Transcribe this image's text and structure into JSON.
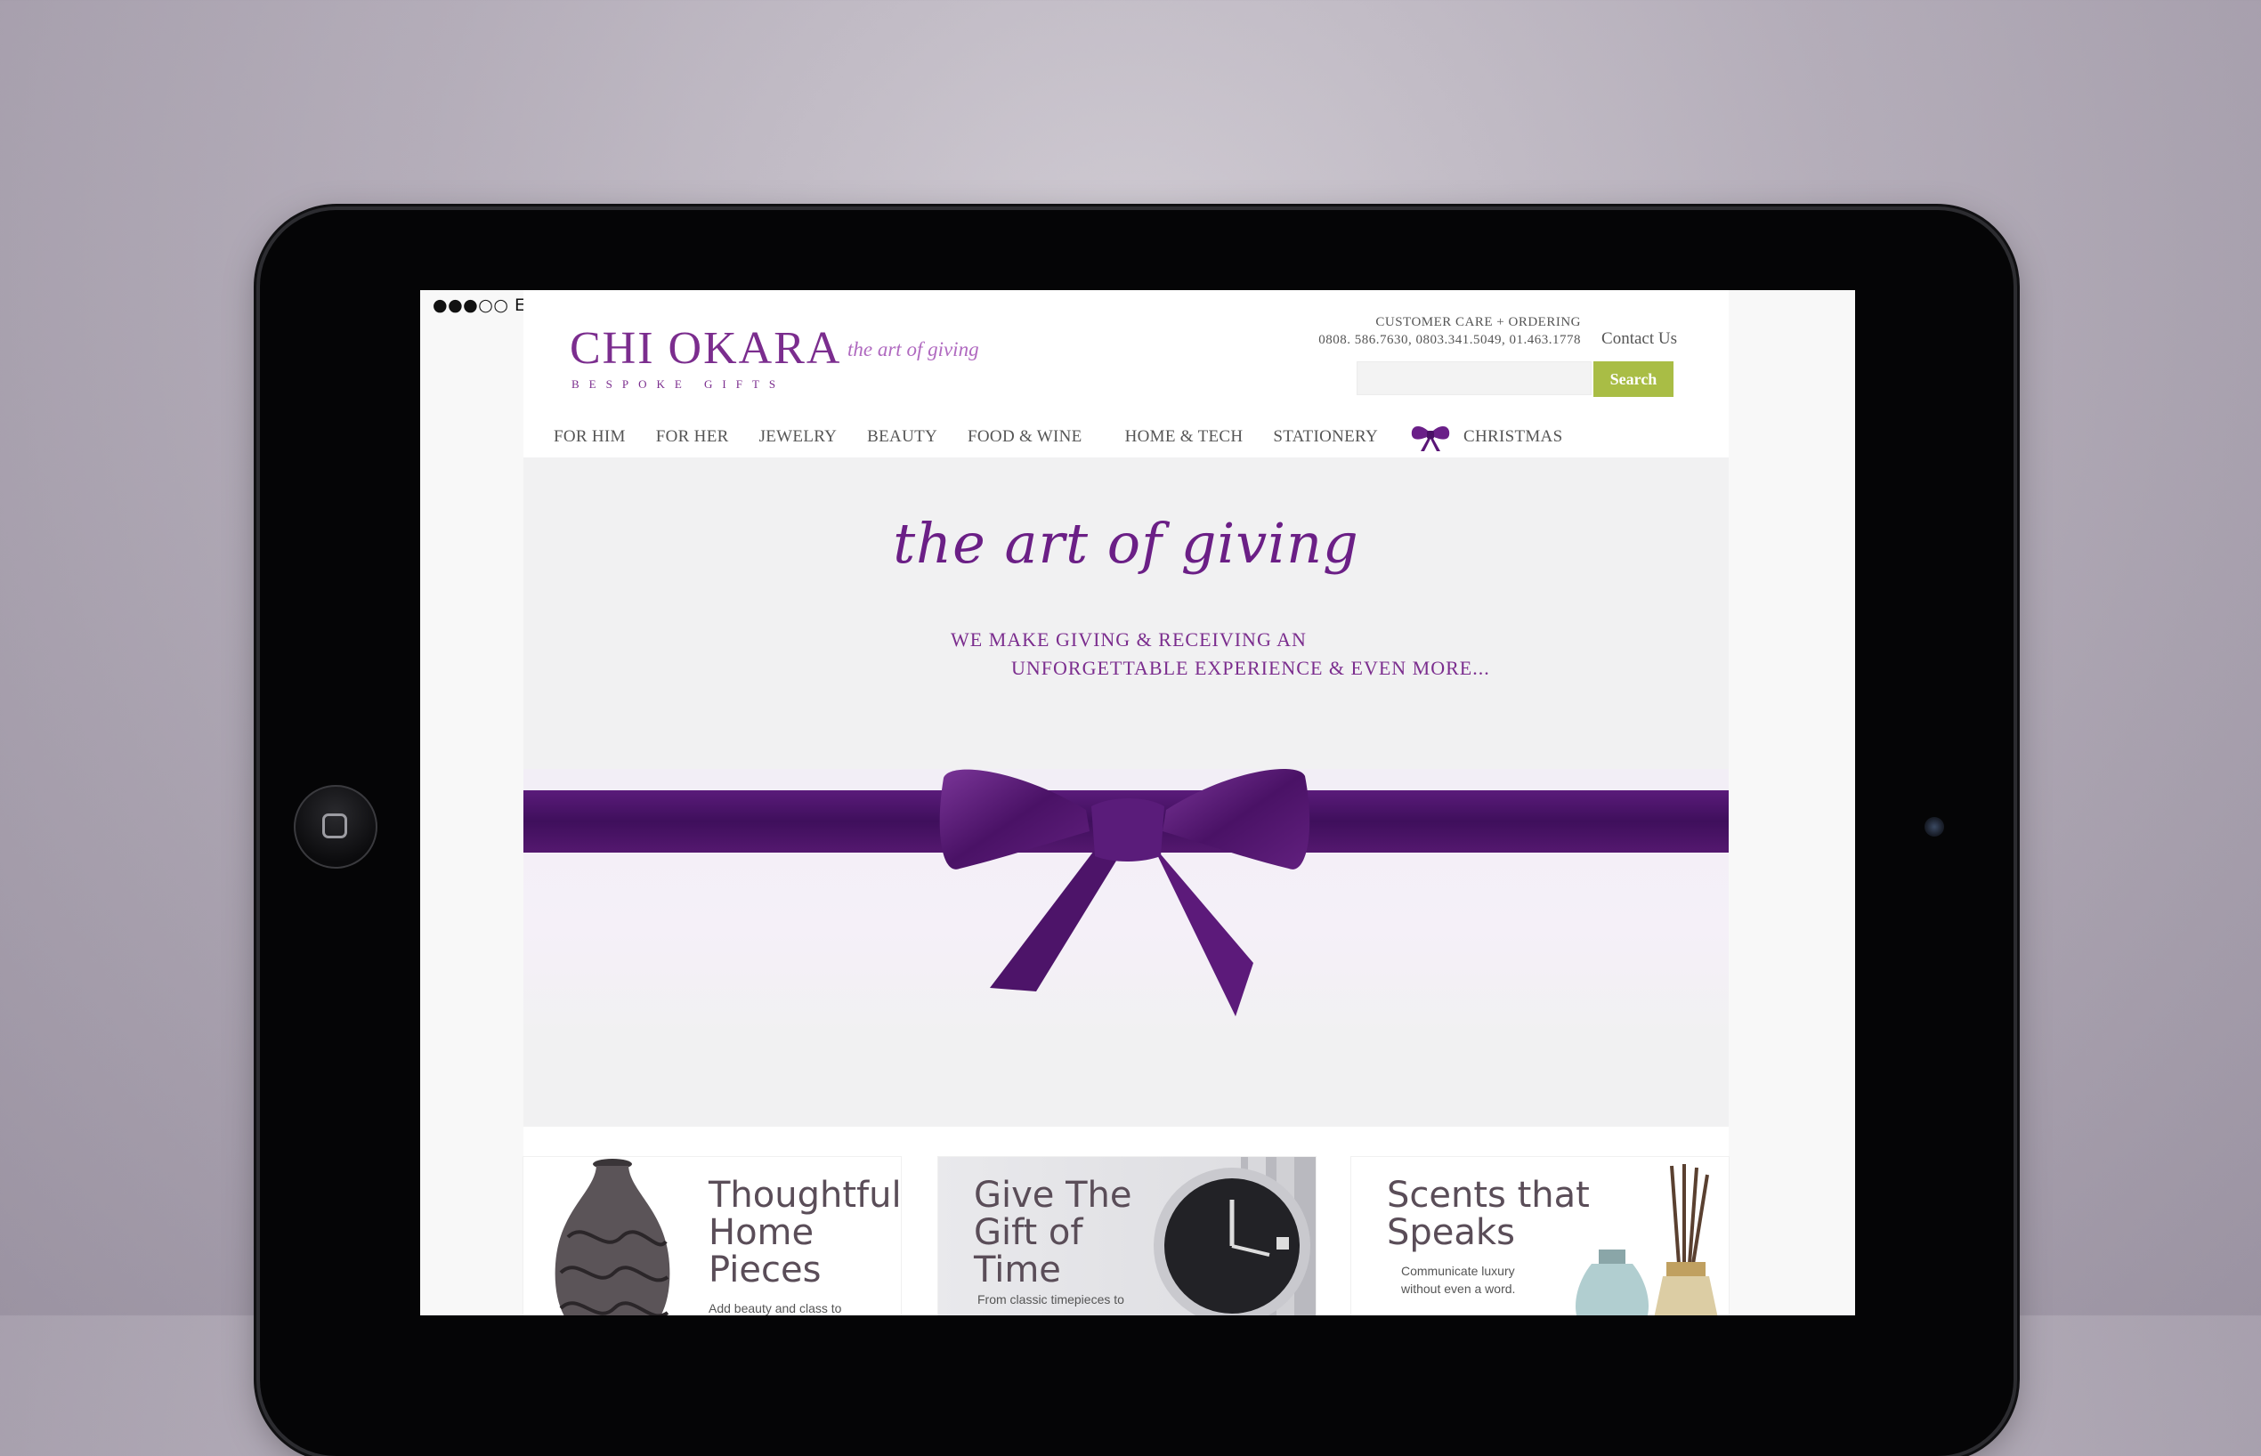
{
  "status_bar": {
    "signal": "●●●○○",
    "carrier": "EMTS"
  },
  "header": {
    "logo": "CHI OKARA",
    "logo_subtitle": "BESPOKE GIFTS",
    "tagline": "the art of giving",
    "customer_care_title": "CUSTOMER CARE + ORDERING",
    "phones": "0808. 586.7630, 0803.341.5049, 01.463.1778",
    "contact_label": "Contact Us",
    "search_placeholder": "",
    "search_button": "Search"
  },
  "nav": {
    "items": [
      "FOR HIM",
      "FOR HER",
      "JEWELRY",
      "BEAUTY",
      "FOOD & WINE",
      "HOME & TECH",
      "STATIONERY",
      "CHRISTMAS"
    ]
  },
  "hero": {
    "script_title": "the art of giving",
    "line1": "WE MAKE GIVING & RECEIVING AN",
    "line2": "UNFORGETTABLE EXPERIENCE & EVEN MORE..."
  },
  "cards": [
    {
      "title": "Thoughtful\nHome\nPieces",
      "text": "Add beauty and class to"
    },
    {
      "title": "Give The\nGift of\nTime",
      "text": "From classic timepieces to"
    },
    {
      "title": "Scents that\nSpeaks",
      "text": "Communicate luxury\nwithout even a word."
    }
  ],
  "colors": {
    "brand_purple": "#7b2d8e",
    "ribbon_purple": "#4a1566",
    "search_green": "#a9bd45",
    "background": "#b4adb9"
  }
}
